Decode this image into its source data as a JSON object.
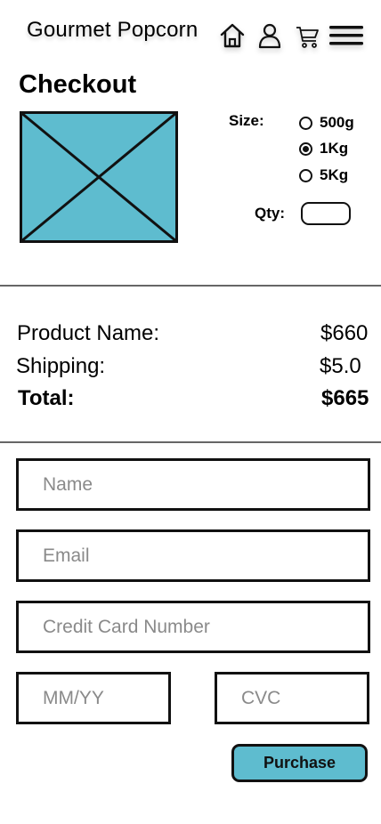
{
  "header": {
    "brand": "Gourmet Popcorn",
    "icons": [
      "home-icon",
      "user-icon",
      "cart-icon",
      "menu-icon"
    ]
  },
  "checkout": {
    "title": "Checkout",
    "image": "product-image-placeholder",
    "placeholder_color": "#5ebccf"
  },
  "options": {
    "size_label": "Size:",
    "sizes": [
      {
        "label": "500g",
        "checked": false
      },
      {
        "label": "1Kg",
        "checked": true
      },
      {
        "label": "5Kg",
        "checked": false
      }
    ],
    "qty_label": "Qty:",
    "qty_value": ""
  },
  "summary": {
    "product_label": "Product Name:",
    "product_value": "$660",
    "shipping_label": "Shipping:",
    "shipping_value": "$5.0",
    "total_label": "Total:",
    "total_value": "$665"
  },
  "form": {
    "name_placeholder": "Name",
    "email_placeholder": "Email",
    "card_placeholder": "Credit Card Number",
    "expiry_placeholder": "MM/YY",
    "cvc_placeholder": "CVC",
    "purchase_label": "Purchase"
  },
  "colors": {
    "accent": "#5ebccf",
    "divider": "#666666",
    "border": "#111111"
  }
}
